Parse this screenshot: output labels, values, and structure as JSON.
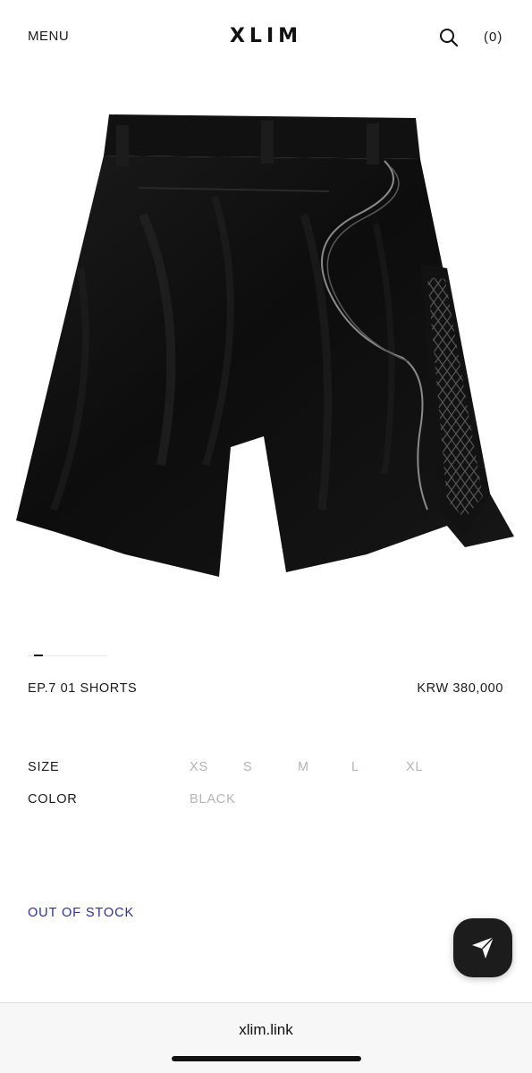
{
  "header": {
    "menu_label": "MENU",
    "logo": "XLIM",
    "search_icon": "search-icon",
    "cart_label": "(0)"
  },
  "product": {
    "name": "EP.7 01 SHORTS",
    "price": "KRW 380,000",
    "image": "black-shorts-product-photo"
  },
  "options": {
    "size_label": "SIZE",
    "sizes": [
      "XS",
      "S",
      "M",
      "L",
      "XL"
    ],
    "color_label": "COLOR",
    "colors": [
      "BLACK"
    ]
  },
  "status": {
    "stock": "OUT OF STOCK"
  },
  "fab": {
    "icon": "send-icon"
  },
  "browser": {
    "url": "xlim.link"
  },
  "colors": {
    "accent_stock": "#2b2fa3",
    "option_disabled": "#b3b3b3",
    "fab_bg": "#1c1c1c"
  }
}
